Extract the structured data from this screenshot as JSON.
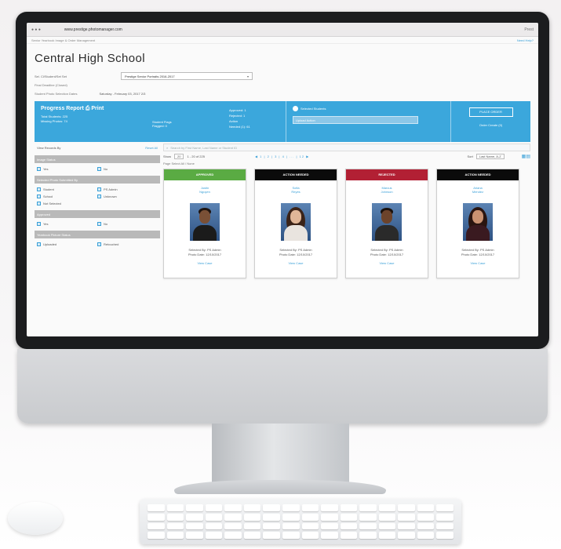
{
  "browser": {
    "url": "www.prestige.photomanager.com",
    "window_text": "Prest",
    "subtitle": "Senior Yearbook Image & Order Management",
    "help_link": "Need Help?"
  },
  "school": {
    "title": "Central High School",
    "location_label": "Sel. Cl/Student/Set Set",
    "location_value": "Prestige Senior Portraits 2016-2017",
    "deadline_label": "Final Deadline (Closed)",
    "date_label": "Student Photo Selection Dates",
    "date_value": "Saturday - February 03, 2017  2/3"
  },
  "progress": {
    "title": "Progress Report",
    "title_extra": "Print",
    "total_students": "Total Students: 225",
    "missing_photos": "Missing Photos: 74",
    "student_flags_label": "Student Flags",
    "student_flags_value": "Flagged: 0",
    "approved": "Approved: 1",
    "rejected": "Rejected: 1",
    "action": "Action",
    "needed": "Needed (1): 61",
    "radio_label": "Selected Students",
    "field_value": "Upload Action",
    "button": "PLACE ORDER",
    "sub_link": "Order Create (0)"
  },
  "filters": {
    "view_label": "View Records By",
    "reset": "Reset All",
    "groups": [
      {
        "title": "Image Status",
        "options": [
          "Yes",
          "No"
        ]
      },
      {
        "title": "Selected Photo Submitted By",
        "options": [
          "Student",
          "PS Admin",
          "School",
          "Unknown",
          "Not Selected"
        ]
      },
      {
        "title": "Approved",
        "options": [
          "Yes",
          "No"
        ]
      },
      {
        "title": "Yearbook Picture Status",
        "options": [
          "Uploaded",
          "Retouched"
        ]
      }
    ]
  },
  "results": {
    "search_placeholder": "Search by First Name, Last Name or Student ID",
    "show_label": "Show",
    "show_value": "20",
    "showing": "1 - 20 of 225",
    "pager": "◀ 1 | 2 | 3 | 4 | ... | 12 ▶",
    "sort_label": "Sort",
    "sort_value": "Last Name, A-Z",
    "page_select": "Page Select All / None"
  },
  "cards": [
    {
      "status": "APPROVED",
      "color": "#5aab43",
      "first": "Justin",
      "last": "Nguyen",
      "selected_by": "Selected By: PS Admin",
      "photo_date": "Photo Date: 12/10/2017",
      "link": "View Case",
      "skin": "#7a5036",
      "hair": "#1e1410",
      "shirt": "#1b1b1b",
      "long_hair": false
    },
    {
      "status": "ACTION NEEDED",
      "color": "#0b0b0b",
      "first": "Sofia",
      "last": "Reyes",
      "selected_by": "Selected By: PS Admin",
      "photo_date": "Photo Date: 12/10/2017",
      "link": "View Case",
      "skin": "#e0b698",
      "hair": "#3b2318",
      "shirt": "#e9e4df",
      "long_hair": true
    },
    {
      "status": "REJECTED",
      "color": "#b22034",
      "first": "Marcus",
      "last": "Johnson",
      "selected_by": "Selected By: PS Admin",
      "photo_date": "Photo Date: 12/10/2017",
      "link": "View Case",
      "skin": "#6c432b",
      "hair": "#1a110c",
      "shirt": "#2a2a2a",
      "long_hair": false
    },
    {
      "status": "ACTION NEEDED",
      "color": "#0b0b0b",
      "first": "Ariana",
      "last": "Mendez",
      "selected_by": "Selected By: PS Admin",
      "photo_date": "Photo Date: 12/10/2017",
      "link": "View Case",
      "skin": "#c99272",
      "hair": "#2a1510",
      "shirt": "#3a1a20",
      "long_hair": true
    }
  ]
}
